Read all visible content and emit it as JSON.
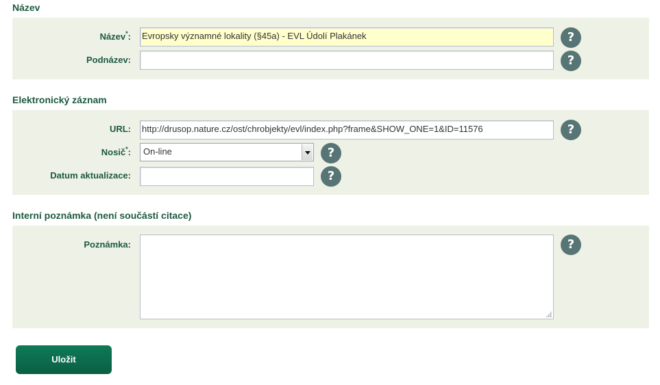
{
  "sections": {
    "nazev": {
      "title": "Název",
      "fields": {
        "nazev": {
          "label": "Název",
          "required_mark": "*",
          "colon": ":",
          "value": "Evropsky významné lokality (§45a) - EVL Údolí Plakánek"
        },
        "podnazev": {
          "label": "Podnázev:",
          "value": ""
        }
      }
    },
    "elektronicky": {
      "title": "Elektronický záznam",
      "fields": {
        "url": {
          "label": "URL:",
          "value": "http://drusop.nature.cz/ost/chrobjekty/evl/index.php?frame&SHOW_ONE=1&ID=11576"
        },
        "nosic": {
          "label": "Nosič",
          "required_mark": "*",
          "colon": ":",
          "value": "On-line"
        },
        "datum": {
          "label": "Datum aktualizace:",
          "value": ""
        }
      }
    },
    "poznamka": {
      "title": "Interní poznámka (není součástí citace)",
      "fields": {
        "poznamka": {
          "label": "Poznámka:",
          "value": ""
        }
      }
    }
  },
  "help_icon": {
    "glyph": "?",
    "name": "help-icon"
  },
  "actions": {
    "save_label": "Uložit"
  },
  "colors": {
    "accent": "#1c5a40",
    "panel_bg": "#eef1e6",
    "required_bg": "#ffffcc",
    "button": "#0a6b4a",
    "help": "#587575"
  }
}
